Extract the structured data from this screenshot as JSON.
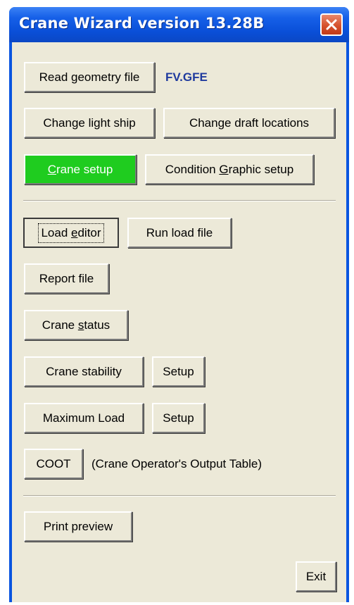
{
  "window": {
    "title": "Crane Wizard version 13.28B"
  },
  "geometry": {
    "read_label": "Read geometry file",
    "filename": "FV.GFE"
  },
  "light_ship_label": "Change light ship",
  "draft_label": "Change draft locations",
  "crane_setup": {
    "mnemonic": "C",
    "rest": "rane setup"
  },
  "condition_graphic": {
    "before": "Condition ",
    "mnemonic": "G",
    "after": "raphic setup"
  },
  "load_editor": {
    "before": "Load ",
    "mnemonic": "e",
    "after": "ditor"
  },
  "run_load_label": "Run load file",
  "report_label": "Report file",
  "crane_status": {
    "before": "Crane ",
    "mnemonic": "s",
    "after": "tatus"
  },
  "stability": {
    "label": "Crane stability",
    "setup": "Setup"
  },
  "max_load": {
    "label": "Maximum Load",
    "setup": "Setup"
  },
  "coot": {
    "label": "COOT",
    "desc": "(Crane Operator's Output Table)"
  },
  "print_preview_label": "Print preview",
  "exit_label": "Exit",
  "colors": {
    "titlebar": "#0a55e0",
    "face": "#ece9d8",
    "green": "#1fcc1f",
    "filename": "#1f3a9e",
    "close": "#d6512c"
  }
}
